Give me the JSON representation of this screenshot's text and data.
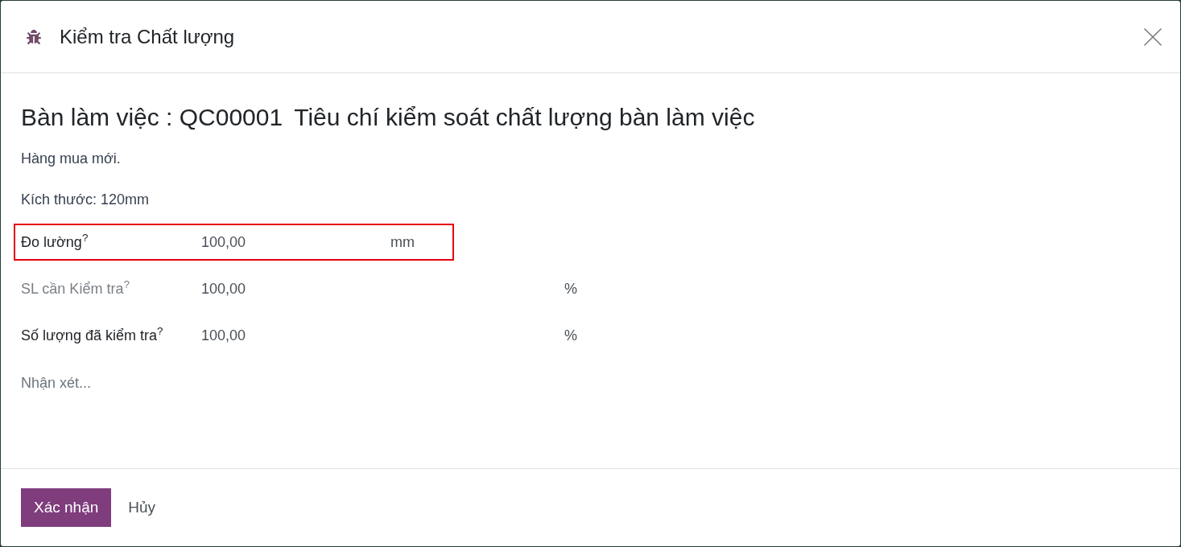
{
  "dialog": {
    "title": "Kiểm tra Chất lượng"
  },
  "heading": {
    "reference": "Bàn làm việc : QC00001",
    "title": "Tiêu chí kiểm soát chất lượng bàn làm việc"
  },
  "notes": [
    "Hàng mua mới.",
    "Kích thước: 120mm"
  ],
  "fields": [
    {
      "kind": "measure",
      "label": "Đo lường$^{?}$",
      "value": "100,00",
      "unit": "mm",
      "readonly": false,
      "highlighted": true
    },
    {
      "kind": "quantity",
      "label": "SL cần Kiểm tra$^{?}$",
      "value": "100,00",
      "unit": "%",
      "readonly": true,
      "highlighted": false
    },
    {
      "kind": "quantity",
      "label": "Số lượng đã kiểm tra$^{?}$",
      "value": "100,00",
      "unit": "%",
      "readonly": false,
      "highlighted": false
    }
  ],
  "comment": {
    "placeholder": "Nhận xét..."
  },
  "buttons": [
    {
      "kind": "primary",
      "label": "Xác nhận"
    },
    {
      "kind": "secondary",
      "label": "Hủy"
    }
  ]
}
